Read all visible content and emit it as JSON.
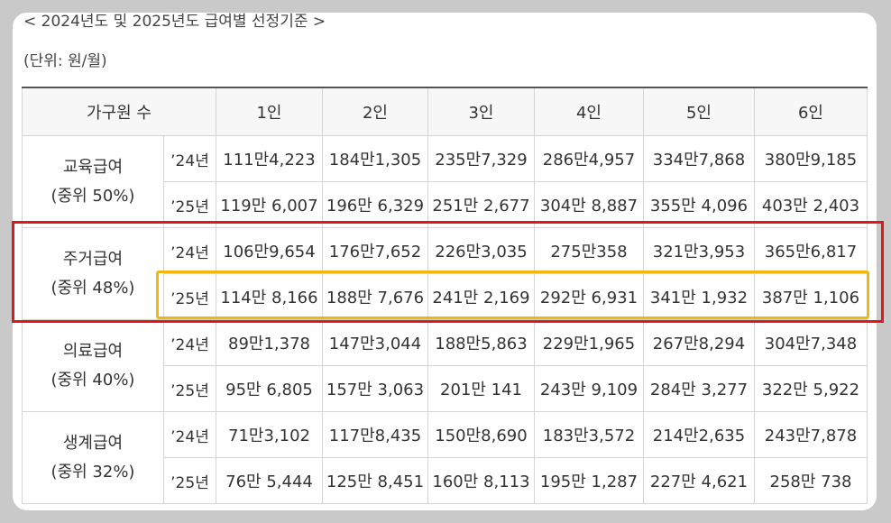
{
  "title": "< 2024년도 및 2025년도 급여별 선정기준 >",
  "unit": "(단위: 원/월)",
  "header": {
    "household": "가구원 수",
    "cols": [
      "1인",
      "2인",
      "3인",
      "4인",
      "5인",
      "6인"
    ]
  },
  "groups": [
    {
      "name": "교육급여",
      "sub": "(중위 50%)",
      "rows": [
        {
          "year": "’24년",
          "values": [
            "111만4,223",
            "184만1,305",
            "235만7,329",
            "286만4,957",
            "334만7,868",
            "380만9,185"
          ]
        },
        {
          "year": "’25년",
          "values": [
            "119만 6,007",
            "196만 6,329",
            "251만 2,677",
            "304만 8,887",
            "355만 4,096",
            "403만 2,403"
          ]
        }
      ]
    },
    {
      "name": "주거급여",
      "sub": "(중위 48%)",
      "rows": [
        {
          "year": "’24년",
          "values": [
            "106만9,654",
            "176만7,652",
            "226만3,035",
            "275만358",
            "321만3,953",
            "365만6,817"
          ]
        },
        {
          "year": "’25년",
          "values": [
            "114만 8,166",
            "188만 7,676",
            "241만 2,169",
            "292만 6,931",
            "341만 1,932",
            "387만 1,106"
          ]
        }
      ]
    },
    {
      "name": "의료급여",
      "sub": "(중위 40%)",
      "rows": [
        {
          "year": "’24년",
          "values": [
            "89만1,378",
            "147만3,044",
            "188만5,863",
            "229만1,965",
            "267만8,294",
            "304만7,348"
          ]
        },
        {
          "year": "’25년",
          "values": [
            "95만 6,805",
            "157만 3,063",
            "201만 141",
            "243만 9,109",
            "284만 3,277",
            "322만 5,922"
          ]
        }
      ]
    },
    {
      "name": "생계급여",
      "sub": "(중위 32%)",
      "rows": [
        {
          "year": "’24년",
          "values": [
            "71만3,102",
            "117만8,435",
            "150만8,690",
            "183만3,572",
            "214만2,635",
            "243만7,878"
          ]
        },
        {
          "year": "’25년",
          "values": [
            "76만 5,444",
            "125만 8,451",
            "160만 8,113",
            "195만 1,287",
            "227만 4,621",
            "258만 738"
          ]
        }
      ]
    }
  ],
  "highlight_colors": {
    "group": "#e01818",
    "row": "#f2b70c"
  }
}
